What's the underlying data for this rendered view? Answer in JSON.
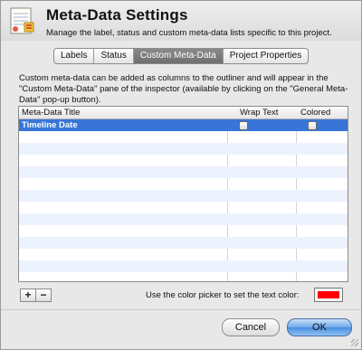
{
  "header": {
    "title": "Meta-Data Settings",
    "subtitle": "Manage the label, status and custom meta-data lists specific to this project."
  },
  "tabs": [
    {
      "label": "Labels",
      "active": false
    },
    {
      "label": "Status",
      "active": false
    },
    {
      "label": "Custom Meta-Data",
      "active": true
    },
    {
      "label": "Project Properties",
      "active": false
    }
  ],
  "description": "Custom meta-data can be added as columns to the outliner and will appear in the \"Custom Meta-Data\" pane of the inspector (available by clicking on the \"General Meta-Data\" pop-up button).",
  "table": {
    "columns": [
      "Meta-Data Title",
      "Wrap Text",
      "Colored Text"
    ],
    "rows": [
      {
        "title": "Timeline Date",
        "wrap_text": false,
        "colored_text": false,
        "selected": true
      }
    ]
  },
  "add_remove": {
    "add": "+",
    "remove": "−"
  },
  "color_picker": {
    "label": "Use the color picker to set the text color:",
    "color": "#ff0000"
  },
  "buttons": {
    "cancel": "Cancel",
    "ok": "OK"
  },
  "icons": {
    "app": "scrivener-document-icon",
    "add": "plus-icon",
    "remove": "minus-icon",
    "resize": "resize-grip-icon"
  },
  "colors": {
    "selection": "#3875d7",
    "default_button": "#4a8fe0"
  }
}
